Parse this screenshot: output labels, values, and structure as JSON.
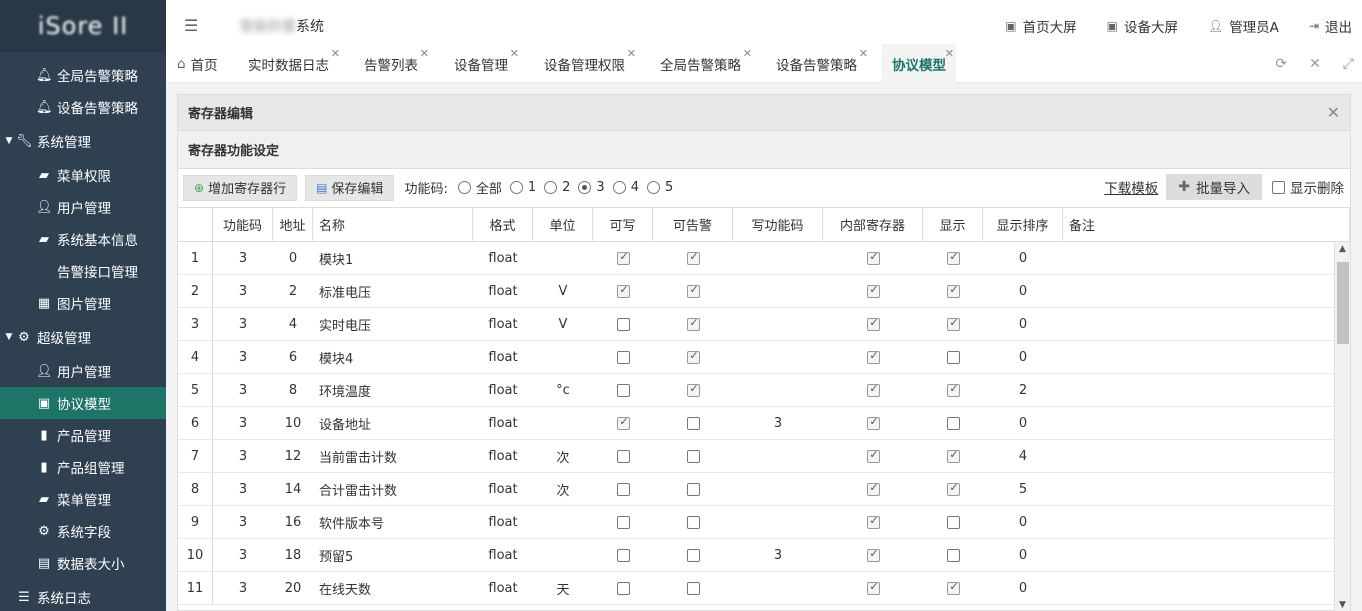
{
  "app": {
    "logo": "iSore II",
    "title_blurred": "智能防雷",
    "title_suffix": "系统"
  },
  "header": {
    "links": [
      {
        "label": "首页大屏",
        "icon": "screen-icon"
      },
      {
        "label": "设备大屏",
        "icon": "screen-icon"
      },
      {
        "label": "管理员A",
        "icon": "user-icon"
      },
      {
        "label": "退出",
        "icon": "logout-icon"
      }
    ]
  },
  "sidebar": {
    "items": [
      {
        "label": "全局告警策略",
        "icon": "bell-icon",
        "type": "sub"
      },
      {
        "label": "设备告警策略",
        "icon": "bell-icon",
        "type": "sub"
      },
      {
        "label": "系统管理",
        "icon": "wrench-icon",
        "type": "group"
      },
      {
        "label": "菜单权限",
        "icon": "book-icon",
        "type": "sub"
      },
      {
        "label": "用户管理",
        "icon": "user-icon",
        "type": "sub"
      },
      {
        "label": "系统基本信息",
        "icon": "book-icon",
        "type": "sub"
      },
      {
        "label": "告警接口管理",
        "icon": "code-icon",
        "type": "sub"
      },
      {
        "label": "图片管理",
        "icon": "grid-icon",
        "type": "sub"
      },
      {
        "label": "超级管理",
        "icon": "gear-icon",
        "type": "group"
      },
      {
        "label": "用户管理",
        "icon": "user-icon",
        "type": "sub"
      },
      {
        "label": "协议模型",
        "icon": "table-icon",
        "type": "sub",
        "active": true
      },
      {
        "label": "产品管理",
        "icon": "bookmark-icon",
        "type": "sub"
      },
      {
        "label": "产品组管理",
        "icon": "bookmark-icon",
        "type": "sub"
      },
      {
        "label": "菜单管理",
        "icon": "book-icon",
        "type": "sub"
      },
      {
        "label": "系统字段",
        "icon": "gear-icon",
        "type": "sub"
      },
      {
        "label": "数据表大小",
        "icon": "save-icon",
        "type": "sub"
      },
      {
        "label": "系统日志",
        "icon": "list-icon",
        "type": "group"
      }
    ]
  },
  "tabs": [
    {
      "label": "首页",
      "closable": false
    },
    {
      "label": "实时数据日志",
      "closable": true
    },
    {
      "label": "告警列表",
      "closable": true
    },
    {
      "label": "设备管理",
      "closable": true
    },
    {
      "label": "设备管理权限",
      "closable": true
    },
    {
      "label": "全局告警策略",
      "closable": true
    },
    {
      "label": "设备告警策略",
      "closable": true
    },
    {
      "label": "协议模型",
      "closable": true,
      "active": true
    }
  ],
  "panel": {
    "title": "寄存器编辑",
    "subtitle": "寄存器功能设定"
  },
  "toolbar": {
    "add_label": "增加寄存器行",
    "save_label": "保存编辑",
    "func_code_label": "功能码:",
    "radios": [
      {
        "label": "全部",
        "checked": false
      },
      {
        "label": "1",
        "checked": false
      },
      {
        "label": "2",
        "checked": false
      },
      {
        "label": "3",
        "checked": true
      },
      {
        "label": "4",
        "checked": false
      },
      {
        "label": "5",
        "checked": false
      }
    ],
    "download_label": "下载模板",
    "import_label": "批量导入",
    "show_deleted_label": "显示删除",
    "show_deleted_checked": false
  },
  "table": {
    "columns": [
      "",
      "功能码",
      "地址",
      "名称",
      "格式",
      "单位",
      "可写",
      "可告警",
      "写功能码",
      "内部寄存器",
      "显示",
      "显示排序",
      "备注"
    ],
    "rows": [
      {
        "idx": "1",
        "fc": "3",
        "addr": "0",
        "name": "模块1",
        "fmt": "float",
        "unit": "",
        "writable": true,
        "alarm": true,
        "wfc": "",
        "internal": true,
        "show": true,
        "order": "0",
        "note": ""
      },
      {
        "idx": "2",
        "fc": "3",
        "addr": "2",
        "name": "标准电压",
        "fmt": "float",
        "unit": "V",
        "writable": true,
        "alarm": true,
        "wfc": "",
        "internal": true,
        "show": true,
        "order": "0",
        "note": ""
      },
      {
        "idx": "3",
        "fc": "3",
        "addr": "4",
        "name": "实时电压",
        "fmt": "float",
        "unit": "V",
        "writable": false,
        "alarm": true,
        "wfc": "",
        "internal": true,
        "show": true,
        "order": "0",
        "note": ""
      },
      {
        "idx": "4",
        "fc": "3",
        "addr": "6",
        "name": "模块4",
        "fmt": "float",
        "unit": "",
        "writable": false,
        "alarm": true,
        "wfc": "",
        "internal": true,
        "show": false,
        "order": "0",
        "note": ""
      },
      {
        "idx": "5",
        "fc": "3",
        "addr": "8",
        "name": "环境温度",
        "fmt": "float",
        "unit": "°c",
        "writable": false,
        "alarm": true,
        "wfc": "",
        "internal": true,
        "show": true,
        "order": "2",
        "note": ""
      },
      {
        "idx": "6",
        "fc": "3",
        "addr": "10",
        "name": "设备地址",
        "fmt": "float",
        "unit": "",
        "writable": true,
        "alarm": false,
        "wfc": "3",
        "internal": true,
        "show": false,
        "order": "0",
        "note": ""
      },
      {
        "idx": "7",
        "fc": "3",
        "addr": "12",
        "name": "当前雷击计数",
        "fmt": "float",
        "unit": "次",
        "writable": false,
        "alarm": false,
        "wfc": "",
        "internal": true,
        "show": true,
        "order": "4",
        "note": ""
      },
      {
        "idx": "8",
        "fc": "3",
        "addr": "14",
        "name": "合计雷击计数",
        "fmt": "float",
        "unit": "次",
        "writable": false,
        "alarm": false,
        "wfc": "",
        "internal": true,
        "show": true,
        "order": "5",
        "note": ""
      },
      {
        "idx": "9",
        "fc": "3",
        "addr": "16",
        "name": "软件版本号",
        "fmt": "float",
        "unit": "",
        "writable": false,
        "alarm": false,
        "wfc": "",
        "internal": true,
        "show": false,
        "order": "0",
        "note": ""
      },
      {
        "idx": "10",
        "fc": "3",
        "addr": "18",
        "name": "预留5",
        "fmt": "float",
        "unit": "",
        "writable": false,
        "alarm": false,
        "wfc": "3",
        "internal": true,
        "show": false,
        "order": "0",
        "note": ""
      },
      {
        "idx": "11",
        "fc": "3",
        "addr": "20",
        "name": "在线天数",
        "fmt": "float",
        "unit": "天",
        "writable": false,
        "alarm": false,
        "wfc": "",
        "internal": true,
        "show": true,
        "order": "0",
        "note": ""
      }
    ]
  },
  "colors": {
    "sidebar_bg": "#2f4050",
    "active_green": "#1c7566"
  }
}
